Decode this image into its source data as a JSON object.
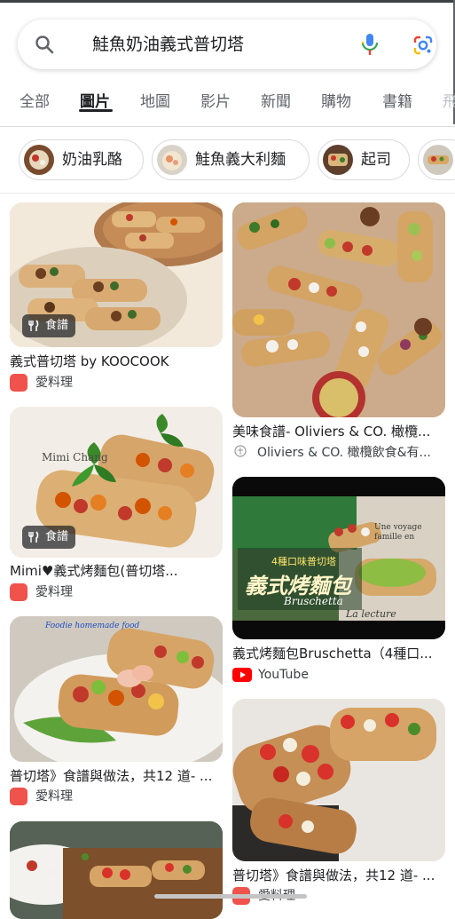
{
  "search": {
    "query": "鮭魚奶油義式普切塔"
  },
  "tabs": [
    {
      "label": "全部"
    },
    {
      "label": "圖片"
    },
    {
      "label": "地圖"
    },
    {
      "label": "影片"
    },
    {
      "label": "新聞"
    },
    {
      "label": "購物"
    },
    {
      "label": "書籍"
    },
    {
      "label": "飛"
    }
  ],
  "chips": [
    {
      "label": "奶油乳酪"
    },
    {
      "label": "鮭魚義大利麵"
    },
    {
      "label": "起司"
    }
  ],
  "results": [
    {
      "title": "義式普切塔 by KOOCOOK",
      "source": "愛料理",
      "badge": "食譜"
    },
    {
      "title": "美味食譜- Oliviers & CO. 橄欖...",
      "source": "Oliviers & CO. 橄欖飲食&有..."
    },
    {
      "title": "Mimi♥義式烤麵包(普切塔...",
      "source": "愛料理",
      "badge": "食譜"
    },
    {
      "title": "義式烤麵包Bruschetta（4種口...",
      "source": "YouTube"
    },
    {
      "title": "普切塔》食譜與做法，共12 道- ...",
      "source": "愛料理"
    },
    {
      "title": "普切塔》食譜與做法，共12 道- ...",
      "source": "愛料理"
    }
  ],
  "image_text": {
    "mimi_watermark": "Mimi Chang",
    "video_line1": "4種口味普切塔",
    "video_line2": "義式烤麵包",
    "video_line3": "Bruschetta",
    "video_corner": "La lecture",
    "video_top": "Une voyage famille en",
    "food_blog": "Foodie homemade food"
  },
  "colors": {
    "accent": "#1a73e8",
    "ailiaoli": "#f0524c",
    "youtube": "#ff0000"
  }
}
